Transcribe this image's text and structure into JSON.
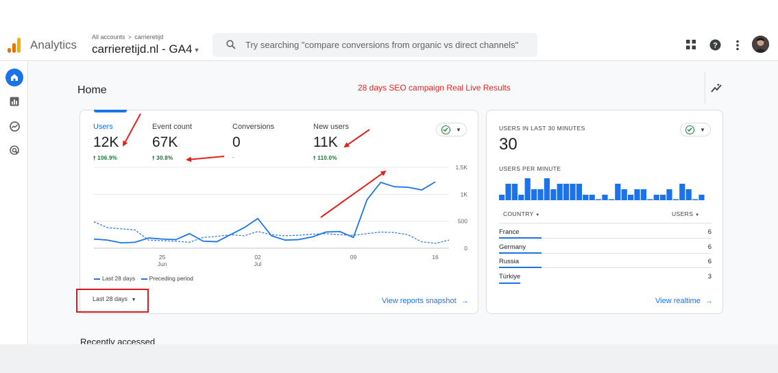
{
  "header": {
    "app_name": "Analytics",
    "account_crumb": "All accounts",
    "account_name": "carrieretijd",
    "property_name": "carrieretijd.nl - GA4",
    "search_placeholder": "Try searching \"compare conversions from organic vs direct channels\"",
    "icons": [
      "apps-grid-icon",
      "help-icon",
      "more-vert-icon"
    ]
  },
  "nav": {
    "items": [
      "home-icon",
      "reports-icon",
      "explore-icon",
      "advertising-icon"
    ],
    "active": "home-icon"
  },
  "page": {
    "title": "Home",
    "annotation": "28 days SEO campaign Real Live Results",
    "recently_accessed": "Recently accessed"
  },
  "overview_card": {
    "metrics": [
      {
        "label": "Users",
        "value": "12K",
        "change": "106.9%",
        "active": true
      },
      {
        "label": "Event count",
        "value": "67K",
        "change": "30.8%",
        "active": false
      },
      {
        "label": "Conversions",
        "value": "0",
        "change": "-",
        "active": false
      },
      {
        "label": "New users",
        "value": "11K",
        "change": "110.0%",
        "active": false
      }
    ],
    "legend": {
      "current": "Last 28 days",
      "previous": "Preceding period"
    },
    "date_range": "Last 28 days",
    "link": "View reports snapshot"
  },
  "chart_data": {
    "type": "line",
    "x_tick_labels": [
      {
        "day": "25",
        "month": "Jun"
      },
      {
        "day": "02",
        "month": "Jul"
      },
      {
        "day": "09",
        "month": ""
      },
      {
        "day": "16",
        "month": ""
      }
    ],
    "y_tick_labels": [
      "1.5K",
      "1K",
      "500",
      "0"
    ],
    "ylim": [
      0,
      1500
    ],
    "grid": true,
    "series": [
      {
        "name": "Last 28 days",
        "style": "solid",
        "values": [
          170,
          150,
          100,
          110,
          190,
          170,
          160,
          270,
          130,
          120,
          250,
          380,
          550,
          230,
          150,
          160,
          210,
          300,
          310,
          200,
          900,
          1220,
          1140,
          1130,
          1080,
          1230
        ]
      },
      {
        "name": "Preceding period",
        "style": "dashed",
        "values": [
          490,
          380,
          360,
          340,
          150,
          140,
          130,
          110,
          200,
          220,
          250,
          230,
          310,
          250,
          230,
          240,
          260,
          270,
          250,
          240,
          270,
          300,
          290,
          250,
          120,
          90,
          150
        ]
      }
    ]
  },
  "realtime_card": {
    "title": "USERS IN LAST 30 MINUTES",
    "value": "30",
    "subtitle": "USERS PER MINUTE",
    "per_minute": [
      1,
      3,
      3,
      1,
      4,
      2,
      2,
      4,
      2,
      3,
      3,
      3,
      3,
      1,
      1,
      0,
      1,
      0,
      3,
      2,
      1,
      2,
      2,
      0,
      1,
      1,
      2,
      0,
      3,
      2,
      0,
      1
    ],
    "table_headers": {
      "country": "COUNTRY",
      "users": "USERS"
    },
    "rows": [
      {
        "country": "France",
        "users": "6",
        "share": 1.0
      },
      {
        "country": "Germany",
        "users": "6",
        "share": 1.0
      },
      {
        "country": "Russia",
        "users": "6",
        "share": 1.0
      },
      {
        "country": "Türkiye",
        "users": "3",
        "share": 0.5
      }
    ],
    "link": "View realtime"
  },
  "colors": {
    "accent": "#1a73e8",
    "positive": "#137333",
    "annotation_red": "#e8211d",
    "logo": [
      "#f9ab00",
      "#e37400",
      "#e37400"
    ]
  }
}
